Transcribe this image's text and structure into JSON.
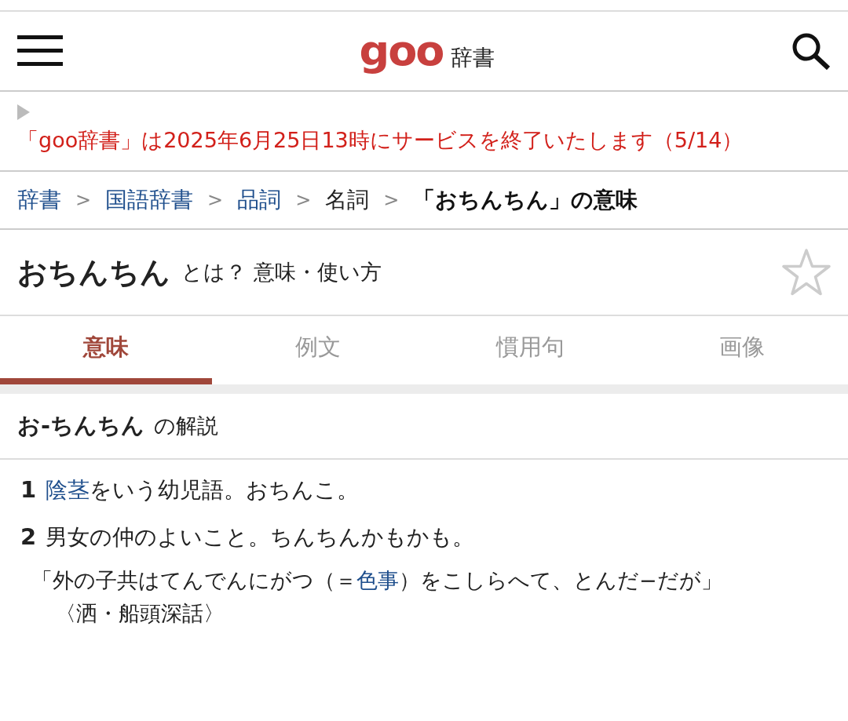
{
  "header": {
    "logo": "goo",
    "site_label": "辞書"
  },
  "notice": {
    "text": "「goo辞書」は2025年6月25日13時にサービスを終了いたします（5/14）"
  },
  "breadcrumbs": [
    {
      "label": "辞書",
      "kind": "link"
    },
    {
      "separator": ">",
      "label": "国語辞書",
      "kind": "link"
    },
    {
      "separator": ">",
      "label": "品詞",
      "kind": "link"
    },
    {
      "separator": ">",
      "label": "名詞",
      "kind": "plain"
    },
    {
      "separator": ">",
      "label": "「おちんちん」の意味",
      "kind": "current"
    }
  ],
  "title": {
    "word": "おちんちん",
    "suffix": "とは？ 意味・使い方"
  },
  "tabs": [
    {
      "label": "意味",
      "selected": true
    },
    {
      "label": "例文",
      "selected": false
    },
    {
      "label": "慣用句",
      "selected": false
    },
    {
      "label": "画像",
      "selected": false
    }
  ],
  "entry": {
    "headword": "お-ちんちん",
    "heading_suffix": "の解説",
    "definitions": [
      {
        "number": "1",
        "segments": [
          {
            "text": "陰茎",
            "link": true
          },
          {
            "text": "をいう幼児語。おちんこ。",
            "link": false
          }
        ]
      },
      {
        "number": "2",
        "segments": [
          {
            "text": "男女の仲のよいこと。ちんちんかもかも。",
            "link": false
          }
        ]
      }
    ],
    "example": {
      "segments": [
        {
          "text": "「外の子共はてんでんにがつ（＝",
          "link": false
        },
        {
          "text": "色事",
          "link": true
        },
        {
          "text": "）をこしらへて、とんだ−だが」",
          "link": false
        }
      ],
      "source": "〈洒・船頭深話〉"
    }
  }
}
